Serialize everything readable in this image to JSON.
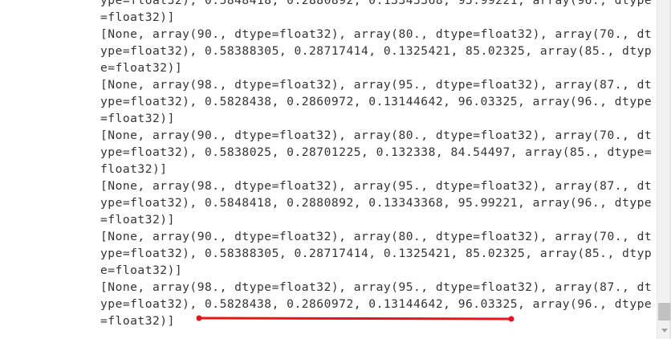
{
  "output": {
    "lines": [
      "ype=float32), 0.5848418, 0.2880892, 0.13343368, 95.99221, array(96., dtype",
      "=float32)]",
      "[None, array(90., dtype=float32), array(80., dtype=float32), array(70., dt",
      "ype=float32), 0.58388305, 0.28717414, 0.1325421, 85.02325, array(85., dtyp",
      "e=float32)]",
      "[None, array(98., dtype=float32), array(95., dtype=float32), array(87., dt",
      "ype=float32), 0.5828438, 0.2860972, 0.13144642, 96.03325, array(96., dtype",
      "=float32)]",
      "[None, array(90., dtype=float32), array(80., dtype=float32), array(70., dt",
      "ype=float32), 0.5838025, 0.28701225, 0.132338, 84.54497, array(85., dtype=",
      "float32)]",
      "[None, array(98., dtype=float32), array(95., dtype=float32), array(87., dt",
      "ype=float32), 0.5848418, 0.2880892, 0.13343368, 95.99221, array(96., dtype",
      "=float32)]",
      "[None, array(90., dtype=float32), array(80., dtype=float32), array(70., dt",
      "ype=float32), 0.58388305, 0.28717414, 0.1325421, 85.02325, array(85., dtyp",
      "e=float32)]",
      "[None, array(98., dtype=float32), array(95., dtype=float32), array(87., dt",
      "ype=float32), 0.5828438, 0.2860972, 0.13144642, 96.03325, array(96., dtype",
      "=float32)]"
    ]
  },
  "colors": {
    "text": "#333333",
    "background": "#ffffff",
    "annotation": "#e8141a",
    "scroll_thumb": "#c1c1c1"
  }
}
